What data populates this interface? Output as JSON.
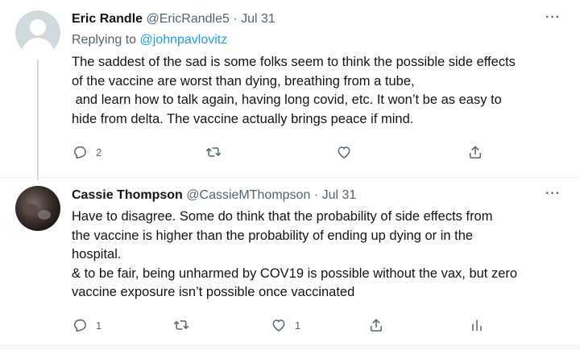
{
  "tweets": [
    {
      "name": "Eric Randle",
      "handle": "@EricRandle5",
      "separator": "·",
      "date": "Jul 31",
      "reply_prefix": "Replying to",
      "reply_to": "@johnpavlovitz",
      "text": "The saddest of the sad is some folks seem to think the possible side effects\nof the vaccine are worst than dying, breathing from a tube,\n and learn how to talk again, having long covid, etc. It won’t be as easy to\nhide from delta. The vaccine actually brings peace if mind.",
      "more": "···",
      "reply_count": "2",
      "retweet_count": "",
      "like_count": ""
    },
    {
      "name": "Cassie Thompson",
      "handle": "@CassieMThompson",
      "separator": "·",
      "date": "Jul 31",
      "text": "Have to disagree. Some do think that the probability of side effects from\nthe vaccine is higher than the probability of ending up dying or in the\nhospital.\n& to be fair, being unharmed by COV19 is possible without the vax, but zero\nvaccine exposure isn’t possible once vaccinated",
      "more": "···",
      "reply_count": "1",
      "retweet_count": "",
      "like_count": "1"
    }
  ],
  "icons": {
    "reply": "reply-icon",
    "retweet": "retweet-icon",
    "like": "heart-icon",
    "share": "share-icon",
    "analytics": "analytics-icon",
    "more": "more-icon"
  },
  "colors": {
    "text": "#0f1419",
    "secondary": "#536471",
    "link": "#1d9bf0",
    "line": "#cfd9de"
  }
}
